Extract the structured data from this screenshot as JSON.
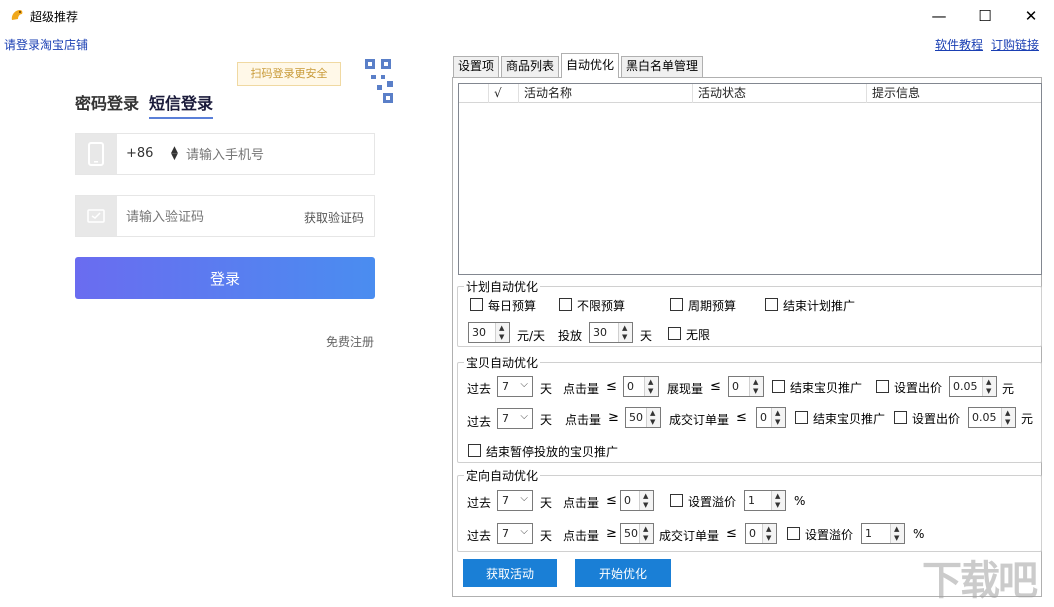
{
  "window": {
    "title": "超级推荐",
    "minimize": "—",
    "maximize": "☐",
    "close": "✕"
  },
  "header": {
    "login_link": "请登录淘宝店铺",
    "tutorial_link": "软件教程",
    "buy_link": "订购链接"
  },
  "login": {
    "tab_password": "密码登录",
    "tab_sms": "短信登录",
    "qr_tip": "扫码登录更安全",
    "phone_code": "+86",
    "phone_placeholder": "请输入手机号",
    "code_placeholder": "请输入验证码",
    "get_code": "获取验证码",
    "login_button": "登录",
    "register": "免费注册"
  },
  "tabs": [
    {
      "label": "设置项"
    },
    {
      "label": "商品列表"
    },
    {
      "label": "自动优化"
    },
    {
      "label": "黑白名单管理"
    }
  ],
  "grid": {
    "columns": [
      "",
      "√",
      "活动名称",
      "活动状态",
      "提示信息"
    ],
    "rows": []
  },
  "plan": {
    "legend": "计划自动优化",
    "daily_budget": "每日预算",
    "unlimited_budget": "不限预算",
    "period_budget": "周期预算",
    "end_plan": "结束计划推广",
    "amount": "30",
    "unit_yuan_day": "元/天",
    "deliver": "投放",
    "days": "30",
    "unit_day": "天",
    "unlimited": "无限"
  },
  "item": {
    "legend": "宝贝自动优化",
    "past": "过去",
    "day": "天",
    "clicks": "点击量",
    "leq": "≤",
    "geq": "≥",
    "impressions": "展现量",
    "orders": "成交订单量",
    "end_item": "结束宝贝推广",
    "set_bid": "设置出价",
    "yuan": "元",
    "row1": {
      "days": "7",
      "clicks": "0",
      "impressions": "0",
      "bid": "0.05"
    },
    "row2": {
      "days": "7",
      "clicks": "50",
      "orders": "0",
      "bid": "0.05"
    },
    "end_paused": "结束暂停投放的宝贝推广"
  },
  "target": {
    "legend": "定向自动优化",
    "past": "过去",
    "day": "天",
    "clicks": "点击量",
    "leq": "≤",
    "geq": "≥",
    "orders": "成交订单量",
    "set_premium": "设置溢价",
    "pct": "%",
    "row1": {
      "days": "7",
      "clicks": "0",
      "premium": "1"
    },
    "row2": {
      "days": "7",
      "clicks": "50",
      "orders": "0",
      "premium": "1"
    }
  },
  "buttons": {
    "fetch": "获取活动",
    "start": "开始优化"
  },
  "watermark": "下载吧"
}
